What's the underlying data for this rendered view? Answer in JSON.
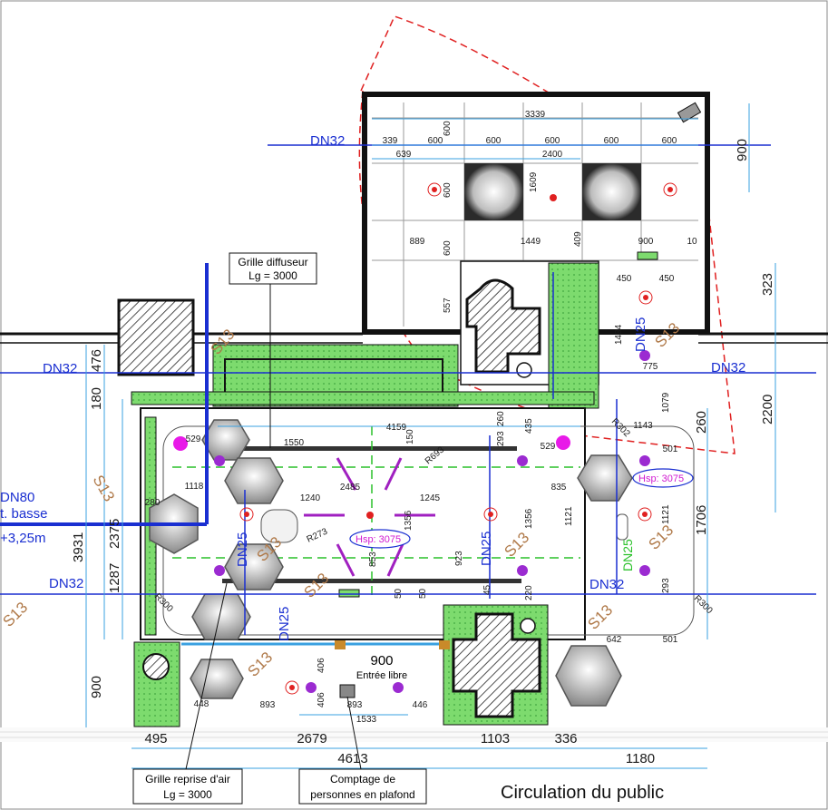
{
  "colors": {
    "pipe_blue": "#1a2fd1",
    "dim_line": "#3aa0e0",
    "sprinkler_orange": "#b07a4a",
    "detector_magenta": "#d11ad1",
    "fire_red": "#e02020",
    "green_zone": "#6fd46f"
  },
  "pipes": {
    "dn32_top": "DN32",
    "dn32_left": "DN32",
    "dn32_right": "DN32",
    "dn32_bottom_left": "DN32",
    "dn32_bottom_right": "DN32",
    "dn25_a": "DN25",
    "dn25_b": "DN25",
    "dn25_c": "DN25",
    "dn25_d": "DN25",
    "dn25_e": "DN25",
    "dn80_line1": "DN80",
    "dn80_line2": "t. basse",
    "dn80_line3": "+3,25m"
  },
  "sprinklers": {
    "s13_1": "S13",
    "s13_2": "S13",
    "s13_3": "S13",
    "s13_4": "S13",
    "s13_5": "S13",
    "s13_6": "S13",
    "s13_7": "S13",
    "s13_8": "S13",
    "s13_9": "S13",
    "s13_10": "S13"
  },
  "heights": {
    "hsp_center": "Hsp: 3075",
    "hsp_right": "Hsp: 3075"
  },
  "callouts": {
    "grille_diffuseur_1": "Grille diffuseur",
    "grille_diffuseur_2": "Lg = 3000",
    "grille_reprise_1": "Grille reprise d'air",
    "grille_reprise_2": "Lg = 3000",
    "comptage_1": "Comptage de",
    "comptage_2": "personnes en plafond",
    "entree_dim": "900",
    "entree_label": "Entrée libre",
    "circulation": "Circulation du public"
  },
  "dims_top_room": {
    "d3339": "3339",
    "d339": "339",
    "d600a": "600",
    "d600b": "600",
    "d600c": "600",
    "d600d": "600",
    "d600e": "600",
    "d639": "639",
    "d2400": "2400",
    "d600v1": "600",
    "d600v2": "600",
    "d600v3": "600",
    "d1609": "1609",
    "d889": "889",
    "d1449": "1449",
    "d409": "409",
    "d900s": "900",
    "d10": "10",
    "d557": "557",
    "d450a": "450",
    "d450b": "450"
  },
  "dims_right": {
    "d900": "900",
    "d323": "323",
    "d2200": "2200",
    "d260": "260",
    "d1706": "1706",
    "d1434": "1434",
    "d775": "775",
    "d1079": "1079",
    "d1143": "1143",
    "d501a": "501",
    "d501b": "501",
    "d1121a": "1121",
    "d1121b": "1121",
    "d293": "293",
    "d642": "642",
    "r302": "R302",
    "r300": "R300"
  },
  "dims_left": {
    "d476": "476",
    "d180": "180",
    "d3931": "3931",
    "d2375": "2375",
    "d1287": "1287",
    "d900": "900",
    "d280": "280",
    "r300": "R300"
  },
  "dims_main": {
    "d4159": "4159",
    "d1550": "1550",
    "d529a": "529",
    "d529b": "529",
    "d1118": "1118",
    "d1240": "1240",
    "d2485": "2485",
    "d1245": "1245",
    "d835": "835",
    "r693": "R693",
    "r273": "R273",
    "d150": "150",
    "d1356a": "1356",
    "d1356b": "1356",
    "d853": "853",
    "d923": "923",
    "d50a": "50",
    "d50b": "50",
    "d45": "45",
    "d220": "220",
    "d293a": "293",
    "d260": "260",
    "d435": "435",
    "d406a": "406",
    "d406b": "406"
  },
  "dims_bottom": {
    "d448": "448",
    "d893a": "893",
    "d893b": "893",
    "d446": "446",
    "d1533": "1533",
    "d495": "495",
    "d2679": "2679",
    "d1103": "1103",
    "d336": "336",
    "d4613": "4613",
    "d1180": "1180"
  }
}
